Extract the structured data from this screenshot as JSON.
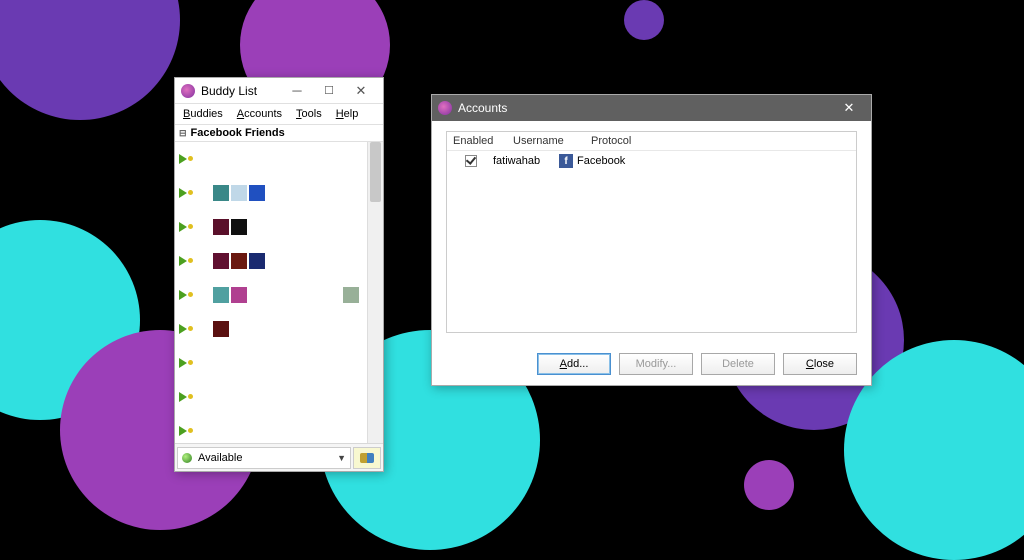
{
  "buddy_window": {
    "title": "Buddy List",
    "menu": {
      "buddies": "Buddies",
      "accounts": "Accounts",
      "tools": "Tools",
      "help": "Help"
    },
    "group": "Facebook Friends",
    "buddies": [
      {
        "avatar_colors": [],
        "name_hint": ""
      },
      {
        "avatar_colors": [
          "#3a8888",
          "#c0d8e8",
          "#2050c0"
        ],
        "name_hint": ""
      },
      {
        "avatar_colors": [
          "#5a102a",
          "#101010"
        ],
        "name_hint": ""
      },
      {
        "avatar_colors": [
          "#601030",
          "#6a1810",
          "#1a2a70"
        ],
        "name_hint": ""
      },
      {
        "avatar_colors": [
          "#50a0a0",
          "#b04090"
        ],
        "right_avatar": [
          "#98b098"
        ],
        "name_hint": ""
      },
      {
        "avatar_colors": [
          "#5a1010"
        ],
        "name_hint": ""
      },
      {
        "avatar_colors": [],
        "name_hint": ""
      },
      {
        "avatar_colors": [],
        "name_hint": ""
      },
      {
        "avatar_colors": [],
        "name_hint": ""
      }
    ],
    "status": "Available"
  },
  "accounts_window": {
    "title": "Accounts",
    "headers": {
      "enabled": "Enabled",
      "username": "Username",
      "protocol": "Protocol"
    },
    "rows": [
      {
        "enabled": true,
        "username": "fatiwahab",
        "protocol": "Facebook"
      }
    ],
    "buttons": {
      "add": "Add...",
      "modify": "Modify...",
      "delete": "Delete",
      "close": "Close"
    }
  }
}
